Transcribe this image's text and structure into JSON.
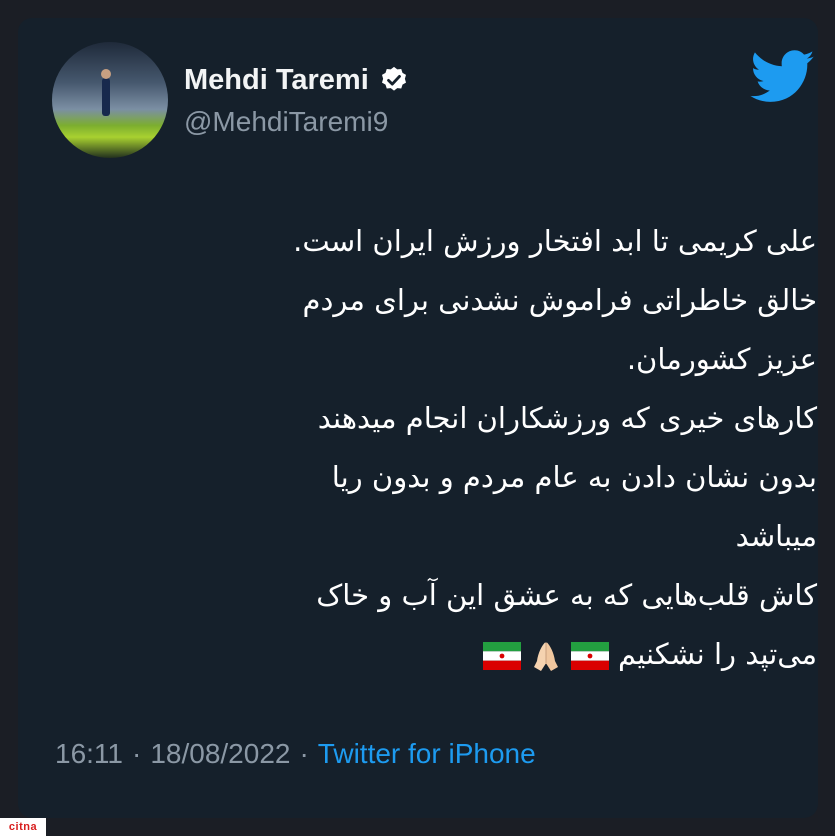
{
  "tweet": {
    "author": {
      "display_name": "Mehdi Taremi",
      "handle": "@MehdiTaremi9",
      "verified": true,
      "avatar_icon": "profile-photo-footballer"
    },
    "brand_icon": "twitter-bird-icon",
    "brand_color": "#1d9bf0",
    "lines": [
      "علی کریمی تا ابد افتخار ورزش ایران است.",
      "خالق خاطراتی فراموش نشدنی برای مردم",
      "عزیز کشورمان.",
      "کارهای خیری که ورزشکاران انجام میدهند",
      "بدون نشان دادن به عام مردم و بدون ریا",
      "میباشد",
      "کاش قلب‌هایی که به عشق این آب و خاک",
      "می‌تپد را نشکنیم"
    ],
    "emoji": [
      "🇮🇷",
      "🙏🏻",
      "🇮🇷"
    ],
    "time": "16:11",
    "date": "18/08/2022",
    "separator": "·",
    "source": "Twitter for iPhone"
  },
  "watermark": "citna",
  "colors": {
    "background": "#15202b",
    "text": "#ffffff",
    "secondary_text": "#8b98a5",
    "link": "#1d9bf0",
    "flag_green": "#239f40",
    "flag_red": "#da0000"
  }
}
